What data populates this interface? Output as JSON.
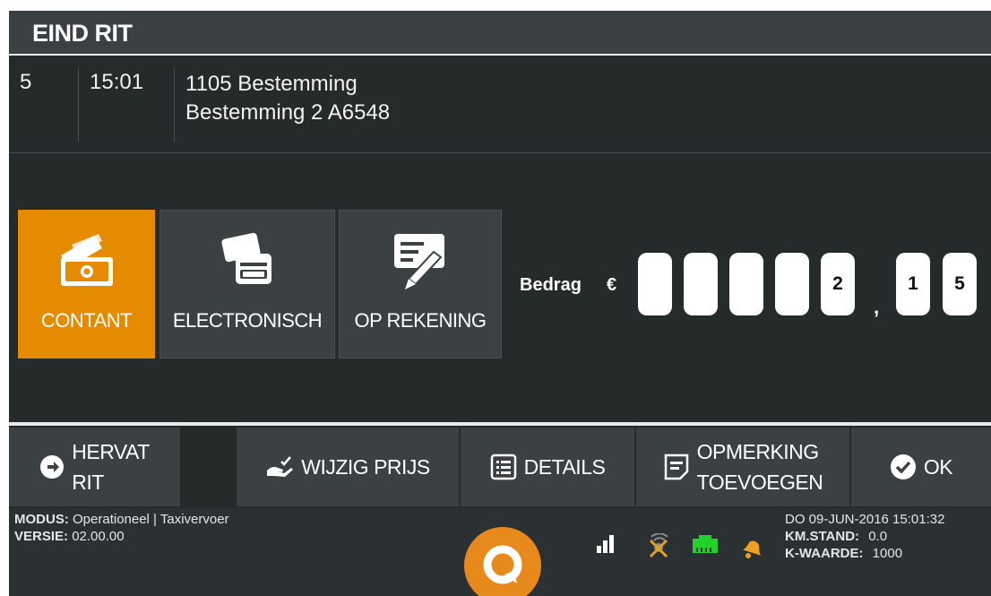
{
  "header": {
    "title": "EIND RIT"
  },
  "ride": {
    "number": "5",
    "time": "15:01",
    "destination_line1": "1105 Bestemming",
    "destination_line2": "Bestemming 2 A6548"
  },
  "payment": {
    "options": [
      {
        "label": "CONTANT",
        "icon": "cash-icon",
        "selected": true
      },
      {
        "label": "ELECTRONISCH",
        "icon": "card-icon",
        "selected": false
      },
      {
        "label": "OP REKENING",
        "icon": "invoice-pen-icon",
        "selected": false
      }
    ],
    "amount_label": "Bedrag",
    "currency": "€",
    "integer_digits": [
      "",
      "",
      "",
      "",
      "2"
    ],
    "decimal_separator": ",",
    "decimal_digits": [
      "1",
      "5"
    ]
  },
  "actions": {
    "resume_line1": "HERVAT",
    "resume_line2": "RIT",
    "change_price": "WIJZIG PRIJS",
    "details": "DETAILS",
    "note_line1": "OPMERKING",
    "note_line2": "TOEVOEGEN",
    "ok": "OK"
  },
  "status": {
    "mode_label": "MODUS:",
    "mode_value": "Operationeel | Taxivervoer",
    "version_label": "VERSIE:",
    "version_value": "02.00.00",
    "datetime": "DO 09-JUN-2016 15:01:32",
    "km_label": "KM.STAND:",
    "km_value": "0.0",
    "k_label": "K-WAARDE:",
    "k_value": "1000",
    "icons": [
      "signal-icon",
      "gps-off-icon",
      "network-icon",
      "bell-icon"
    ]
  },
  "colors": {
    "accent": "#e68a00",
    "panel": "#3b4143",
    "background": "#252a2b",
    "network": "#23d12a"
  }
}
